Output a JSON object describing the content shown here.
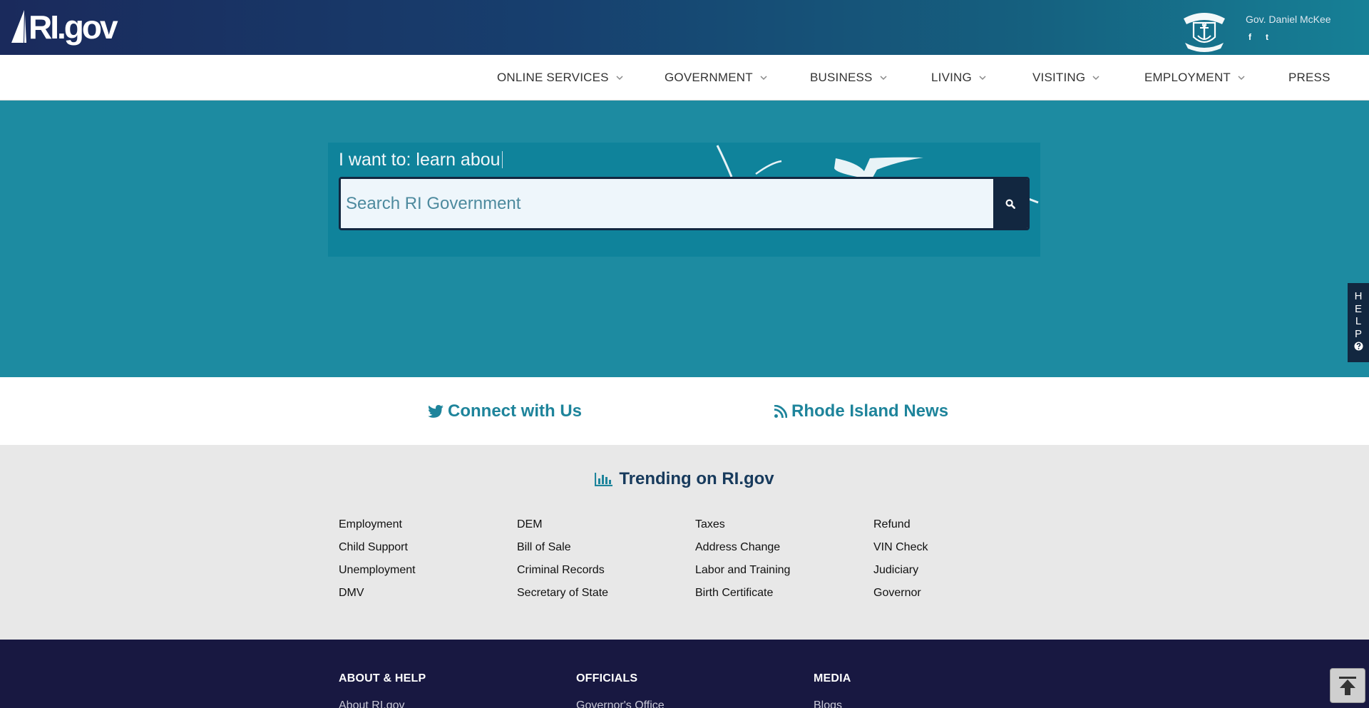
{
  "header": {
    "logo_text": "RI.gov",
    "governor": "Gov. Daniel McKee",
    "social": [
      "facebook-icon",
      "twitter-icon"
    ],
    "social_glyphs": [
      "f",
      "t"
    ]
  },
  "nav": {
    "items": [
      {
        "label": "ONLINE SERVICES",
        "has_dropdown": true
      },
      {
        "label": "GOVERNMENT",
        "has_dropdown": true
      },
      {
        "label": "BUSINESS",
        "has_dropdown": true
      },
      {
        "label": "LIVING",
        "has_dropdown": true
      },
      {
        "label": "VISITING",
        "has_dropdown": true
      },
      {
        "label": "EMPLOYMENT",
        "has_dropdown": true
      },
      {
        "label": "PRESS",
        "has_dropdown": false
      }
    ]
  },
  "hero": {
    "prompt": "I want to: learn abou",
    "search_placeholder": "Search RI Government",
    "search_value": "",
    "search_button_icon": "search-icon"
  },
  "help_tab": {
    "letters": [
      "H",
      "E",
      "L",
      "P"
    ],
    "icon": "question-circle-icon"
  },
  "connect": {
    "social_label": "Connect with Us",
    "news_label": "Rhode Island News"
  },
  "trending": {
    "title": "Trending on RI.gov",
    "columns": [
      [
        "Employment",
        "Child Support",
        "Unemployment",
        "DMV"
      ],
      [
        "DEM",
        "Bill of Sale",
        "Criminal Records",
        "Secretary of State"
      ],
      [
        "Taxes",
        "Address Change",
        "Labor and Training",
        "Birth Certificate"
      ],
      [
        "Refund",
        "VIN Check",
        "Judiciary",
        "Governor"
      ]
    ]
  },
  "footer": {
    "columns": [
      {
        "heading": "ABOUT & HELP",
        "first_link": "About RI.gov"
      },
      {
        "heading": "OFFICIALS",
        "first_link": "Governor's Office"
      },
      {
        "heading": "MEDIA",
        "first_link": "Blogs"
      }
    ],
    "back_to_top_icon": "arrow-to-top-icon"
  },
  "colors": {
    "header_gradient_start": "#1a2a5c",
    "header_gradient_end": "#168096",
    "hero_bg": "#1d8ba1",
    "search_panel_bg": "#0f839b",
    "dark_navy": "#122740",
    "accent_teal": "#1e849b",
    "trending_bg": "#e8e8e8",
    "footer_bg": "#181841"
  }
}
